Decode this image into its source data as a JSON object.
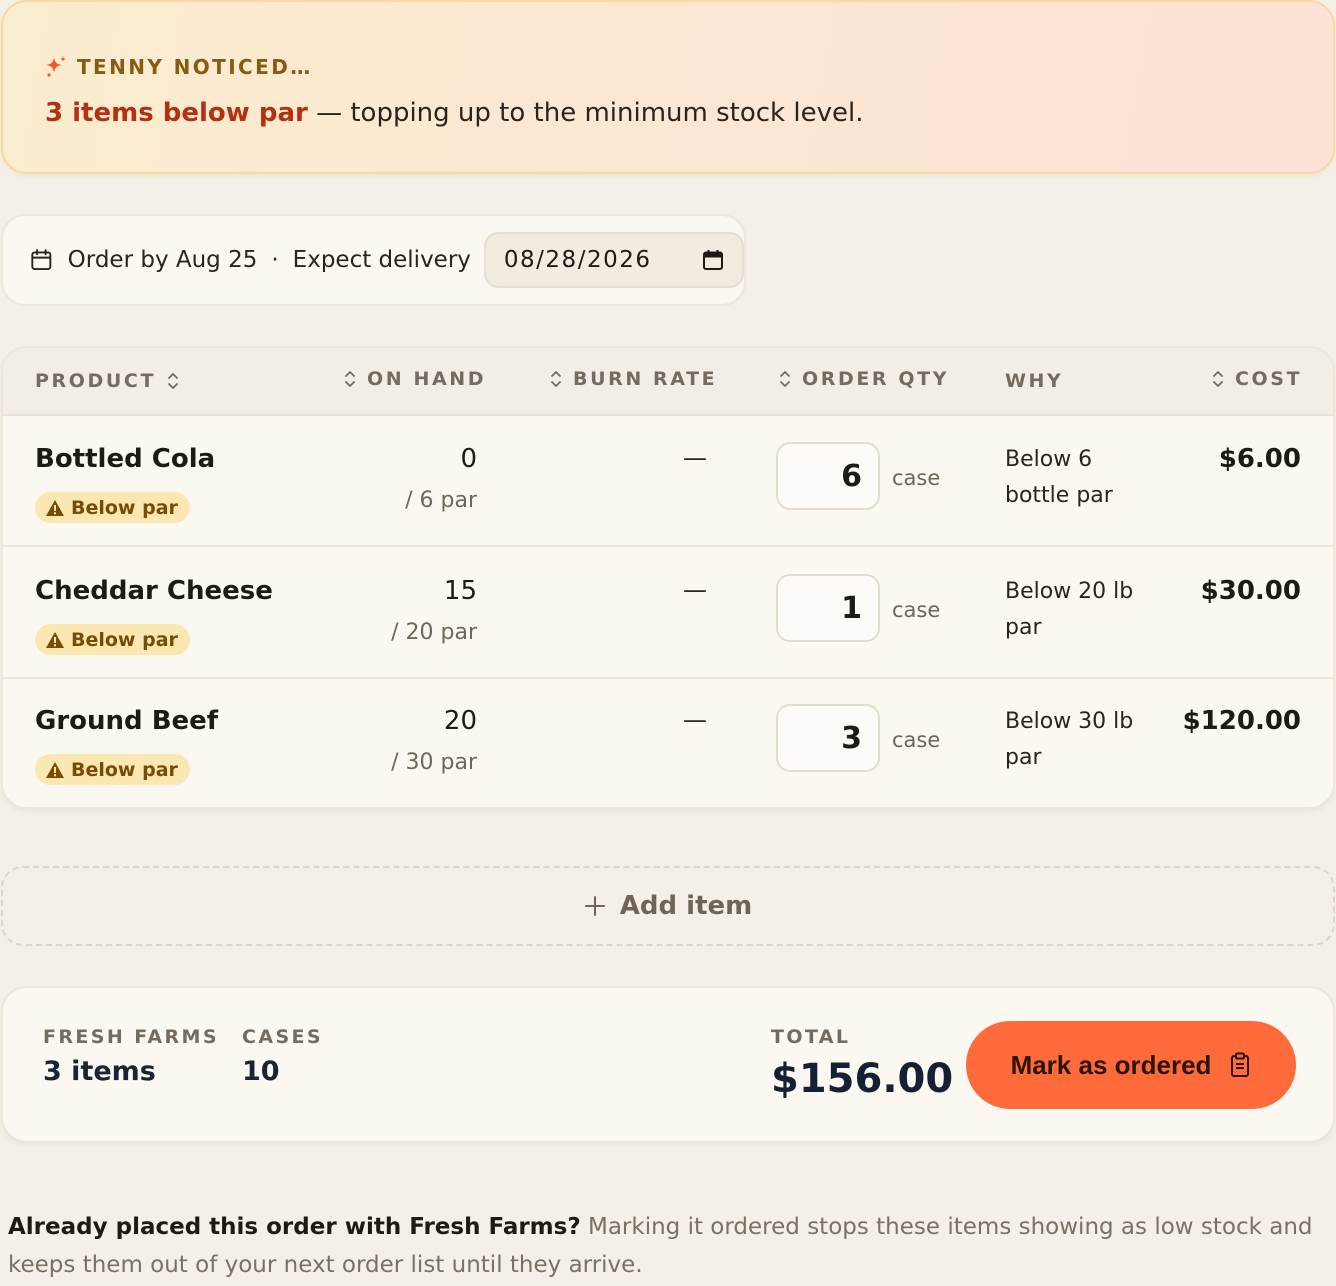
{
  "insight": {
    "eyebrow": "TENNY NOTICED…",
    "highlight": "3 items below par",
    "message": " — topping up to the minimum stock level.",
    "icon": "sparkle-icon"
  },
  "schedule": {
    "order_by": "Order by Aug 25",
    "separator": "·",
    "expect_label": "Expect delivery",
    "delivery_date": "08/28/2026"
  },
  "table": {
    "columns": {
      "product": "PRODUCT",
      "on_hand": "ON HAND",
      "burn_rate": "BURN RATE",
      "order_qty": "ORDER QTY",
      "why": "WHY",
      "cost": "COST"
    },
    "rows": [
      {
        "product": "Bottled Cola",
        "badge": "Below par",
        "on_hand": "0",
        "par": "/ 6 par",
        "burn_rate": "—",
        "qty": "6",
        "unit": "case",
        "why": "Below 6 bottle par",
        "cost": "$6.00"
      },
      {
        "product": "Cheddar Cheese",
        "badge": "Below par",
        "on_hand": "15",
        "par": "/ 20 par",
        "burn_rate": "—",
        "qty": "1",
        "unit": "case",
        "why": "Below 20 lb par",
        "cost": "$30.00"
      },
      {
        "product": "Ground Beef",
        "badge": "Below par",
        "on_hand": "20",
        "par": "/ 30 par",
        "burn_rate": "—",
        "qty": "3",
        "unit": "case",
        "why": "Below 30 lb par",
        "cost": "$120.00"
      }
    ]
  },
  "add_item": {
    "label": "Add item"
  },
  "summary": {
    "supplier_label": "FRESH FARMS",
    "supplier_value": "3 items",
    "cases_label": "CASES",
    "cases_value": "10",
    "total_label": "TOTAL",
    "total_value": "$156.00",
    "cta_label": "Mark as ordered"
  },
  "footnote": {
    "bold": "Already placed this order with Fresh Farms?",
    "text": " Marking it ordered stops these items showing as low stock and keeps them out of your next order list until they arrive."
  },
  "colors": {
    "accent": "#ff6a3a",
    "highlight_text": "#b3310f",
    "badge_bg": "#fbe7b2",
    "badge_text": "#7a4b05",
    "page_bg": "#f5f0e7"
  }
}
